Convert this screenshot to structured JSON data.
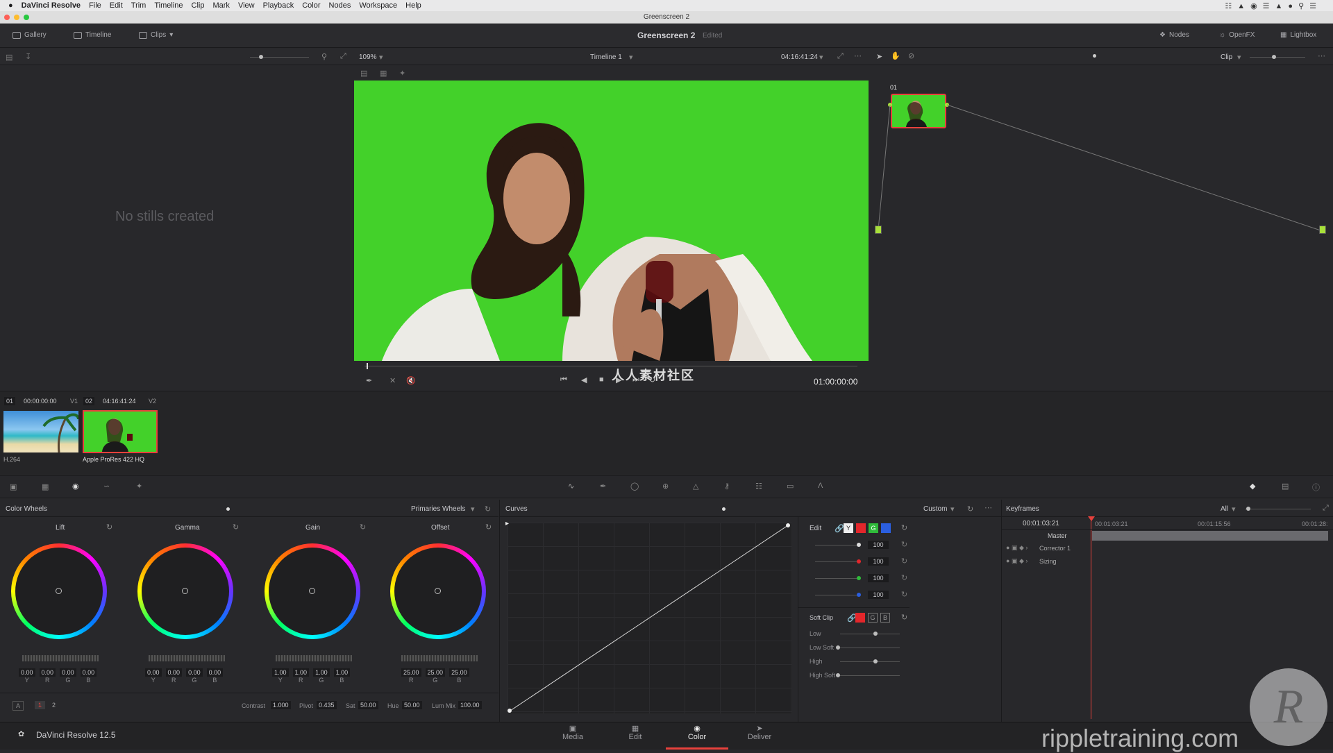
{
  "menubar": {
    "apple": "",
    "app": "DaVinci Resolve",
    "items": [
      "File",
      "Edit",
      "Trim",
      "Timeline",
      "Clip",
      "Mark",
      "View",
      "Playback",
      "Color",
      "Nodes",
      "Workspace",
      "Help"
    ]
  },
  "window": {
    "title": "Greenscreen 2"
  },
  "toolbar": {
    "gallery": "Gallery",
    "timeline": "Timeline",
    "clips": "Clips",
    "project": "Greenscreen 2",
    "status": "Edited",
    "nodes": "Nodes",
    "openfx": "OpenFX",
    "lightbox": "Lightbox"
  },
  "viewer": {
    "zoom": "109%",
    "timeline_name": "Timeline 1",
    "timecode": "04:16:41:24",
    "clip_mode": "Clip",
    "playhead_tc": "01:00:00:00"
  },
  "gallery": {
    "empty_text": "No stills created"
  },
  "nodes": {
    "node_label": "01"
  },
  "clips": {
    "c1_num": "01",
    "c1_tc": "00:00:00:00",
    "c1_track": "V1",
    "c1_codec": "H.264",
    "c2_num": "02",
    "c2_tc": "04:16:41:24",
    "c2_track": "V2",
    "c2_codec": "Apple ProRes 422 HQ"
  },
  "colorwheels": {
    "title": "Color Wheels",
    "mode": "Primaries Wheels",
    "lift": {
      "label": "Lift",
      "vals": [
        "0.00",
        "0.00",
        "0.00",
        "0.00"
      ]
    },
    "gamma": {
      "label": "Gamma",
      "vals": [
        "0.00",
        "0.00",
        "0.00",
        "0.00"
      ]
    },
    "gain": {
      "label": "Gain",
      "vals": [
        "1.00",
        "1.00",
        "1.00",
        "1.00"
      ]
    },
    "offset": {
      "label": "Offset",
      "vals": [
        "25.00",
        "25.00",
        "25.00"
      ]
    },
    "ch4": [
      "Y",
      "R",
      "G",
      "B"
    ],
    "ch3": [
      "R",
      "G",
      "B"
    ],
    "tab_a": "A",
    "tab_1": "1",
    "tab_2": "2",
    "contrast_label": "Contrast",
    "contrast": "1.000",
    "pivot_label": "Pivot",
    "pivot": "0.435",
    "sat_label": "Sat",
    "sat": "50.00",
    "hue_label": "Hue",
    "hue": "50.00",
    "lummix_label": "Lum Mix",
    "lummix": "100.00"
  },
  "curves": {
    "title": "Curves",
    "mode": "Custom",
    "edit_label": "Edit",
    "y": "Y",
    "r_val": "100",
    "g_val": "100",
    "b_val": "100",
    "y_val": "100",
    "g": "G",
    "b": "B",
    "softclip_label": "Soft Clip",
    "low": "Low",
    "low_soft": "Low Soft",
    "high": "High",
    "high_soft": "High Soft"
  },
  "keyframes": {
    "title": "Keyframes",
    "filter": "All",
    "tc_current": "00:01:03:21",
    "tc1": "00:01:03:21",
    "tc2": "00:01:15:56",
    "tc3": "00:01:28:",
    "master": "Master",
    "corrector": "Corrector 1",
    "sizing": "Sizing"
  },
  "pages": {
    "media": "Media",
    "edit": "Edit",
    "color": "Color",
    "deliver": "Deliver"
  },
  "footer": {
    "app_version": "DaVinci Resolve 12.5"
  },
  "watermark": {
    "text": "rippletraining.com",
    "cn": "人人素材社区"
  },
  "colors": {
    "accent": "#e8413c",
    "green": "#43d12a"
  }
}
